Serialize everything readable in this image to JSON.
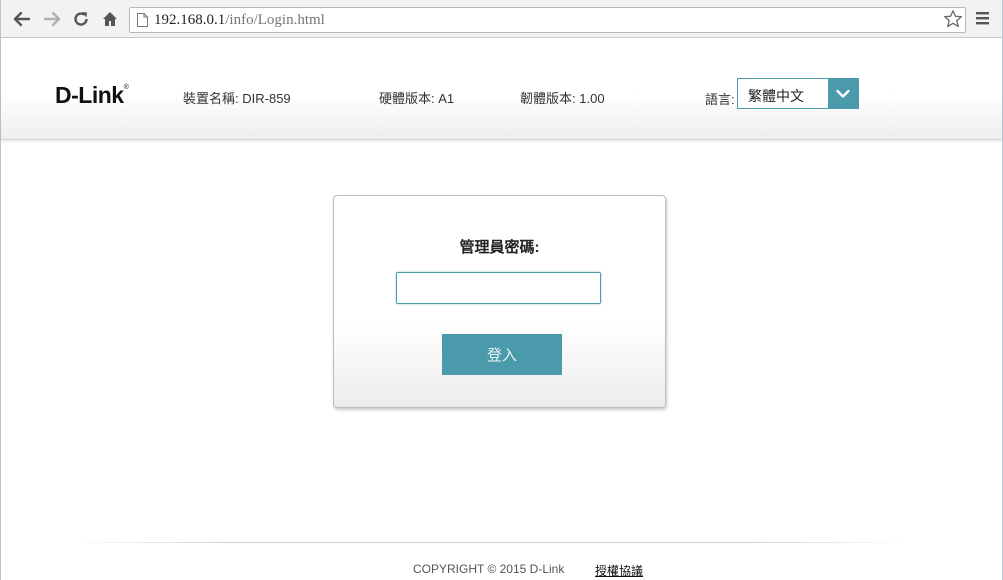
{
  "browser": {
    "url_host": "192.168.0.1",
    "url_path": "/info/Login.html",
    "icons": {
      "back": "back-arrow-icon",
      "forward": "forward-arrow-icon",
      "reload": "reload-icon",
      "home": "home-icon",
      "page": "page-icon",
      "bookmark": "star-icon",
      "menu": "hamburger-menu-icon"
    }
  },
  "header": {
    "logo": "D-Link",
    "logo_mark": "®",
    "device_name_label": "裝置名稱:",
    "device_name_value": "DIR-859",
    "hardware_label": "硬體版本:",
    "hardware_value": "A1",
    "firmware_label": "韌體版本:",
    "firmware_value": "1.00",
    "language_label": "語言:",
    "language_selected": "繁體中文"
  },
  "login": {
    "title": "管理員密碼:",
    "password_value": "",
    "button_label": "登入"
  },
  "footer": {
    "copyright": "COPYRIGHT © 2015 D-Link",
    "license_link": "授權協議"
  },
  "colors": {
    "accent": "#4a9aab"
  }
}
